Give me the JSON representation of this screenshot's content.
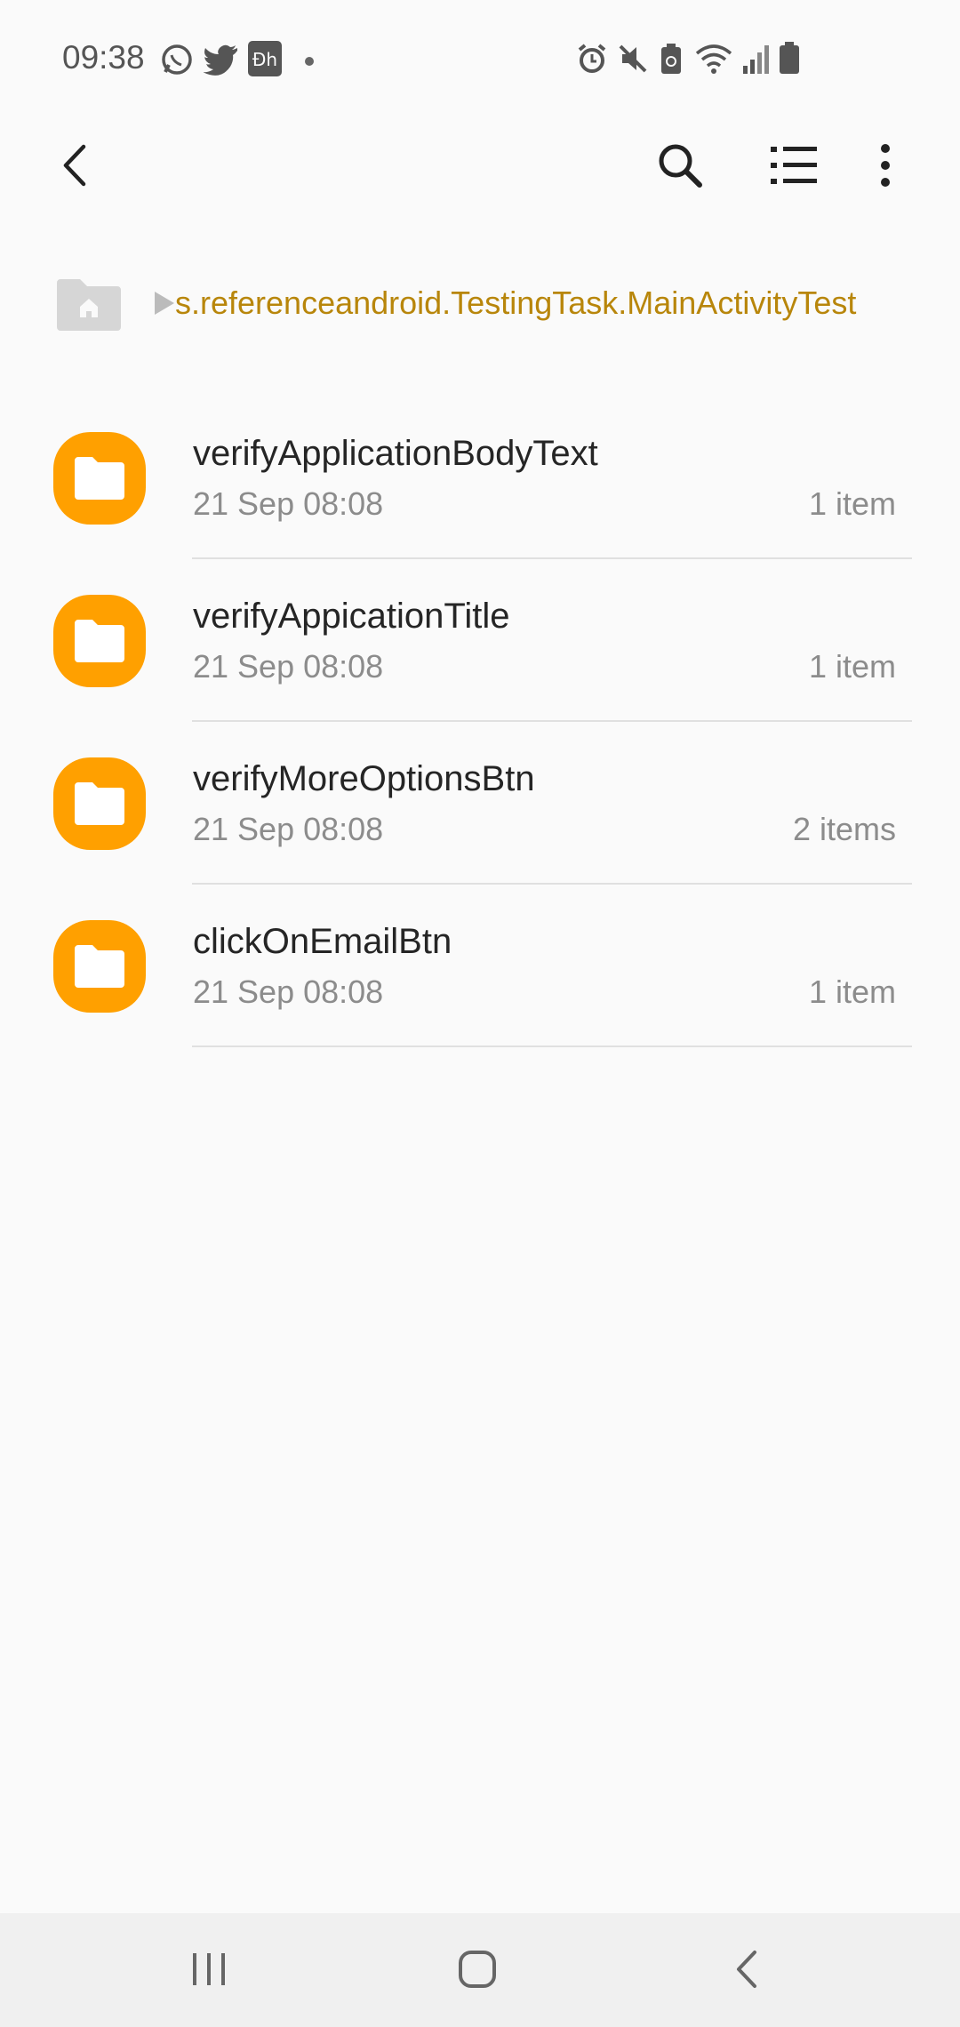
{
  "status_bar": {
    "time": "09:38",
    "left_icons": [
      "whatsapp-icon",
      "twitter-icon",
      "disney-plus-hotstar-icon"
    ],
    "right_icons": [
      "alarm-icon",
      "mute-icon",
      "battery-saver-icon",
      "wifi-icon",
      "signal-icon",
      "battery-icon"
    ]
  },
  "toolbar": {
    "back_icon": "chevron-left-icon",
    "search_icon": "search-icon",
    "view_icon": "list-view-icon",
    "more_icon": "more-vertical-icon"
  },
  "breadcrumb": {
    "home_icon": "home-folder-icon",
    "path": "s.referenceandroid.TestingTask.MainActivityTest"
  },
  "colors": {
    "accent": "#b8860b",
    "folder": "#ffa000"
  },
  "folders": [
    {
      "name": "verifyApplicationBodyText",
      "date": "21 Sep 08:08",
      "count": "1 item"
    },
    {
      "name": "verifyAppicationTitle",
      "date": "21 Sep 08:08",
      "count": "1 item"
    },
    {
      "name": "verifyMoreOptionsBtn",
      "date": "21 Sep 08:08",
      "count": "2 items"
    },
    {
      "name": "clickOnEmailBtn",
      "date": "21 Sep 08:08",
      "count": "1 item"
    }
  ],
  "nav_bar": {
    "recents_icon": "recents-icon",
    "home_icon": "home-icon",
    "back_icon": "back-icon"
  }
}
